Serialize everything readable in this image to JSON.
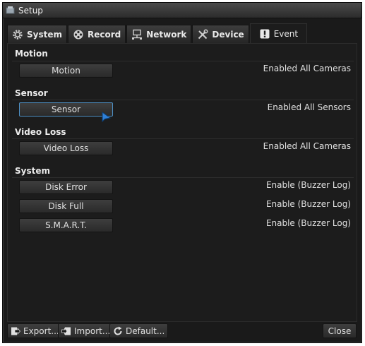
{
  "window": {
    "title": "Setup"
  },
  "tabs": [
    {
      "label": "System",
      "icon": "gear-icon"
    },
    {
      "label": "Record",
      "icon": "film-reel-icon"
    },
    {
      "label": "Network",
      "icon": "network-icon"
    },
    {
      "label": "Device",
      "icon": "tools-icon"
    },
    {
      "label": "Event",
      "icon": "exclamation-icon",
      "active": true
    }
  ],
  "sections": {
    "motion": {
      "title": "Motion",
      "button": "Motion",
      "status": "Enabled All Cameras"
    },
    "sensor": {
      "title": "Sensor",
      "button": "Sensor",
      "status": "Enabled All Sensors"
    },
    "video_loss": {
      "title": "Video Loss",
      "button": "Video Loss",
      "status": "Enabled All Cameras"
    },
    "system": {
      "title": "System",
      "items": [
        {
          "button": "Disk Error",
          "status": "Enable (Buzzer Log)"
        },
        {
          "button": "Disk Full",
          "status": "Enable (Buzzer Log)"
        },
        {
          "button": "S.M.A.R.T.",
          "status": "Enable (Buzzer Log)"
        }
      ]
    }
  },
  "footer": {
    "export_label": "Export...",
    "import_label": "Import...",
    "default_label": "Default...",
    "close_label": "Close"
  },
  "colors": {
    "background": "#1a1a1a",
    "focus_border": "#4d8fc4",
    "cursor": "#2f7fd6"
  }
}
